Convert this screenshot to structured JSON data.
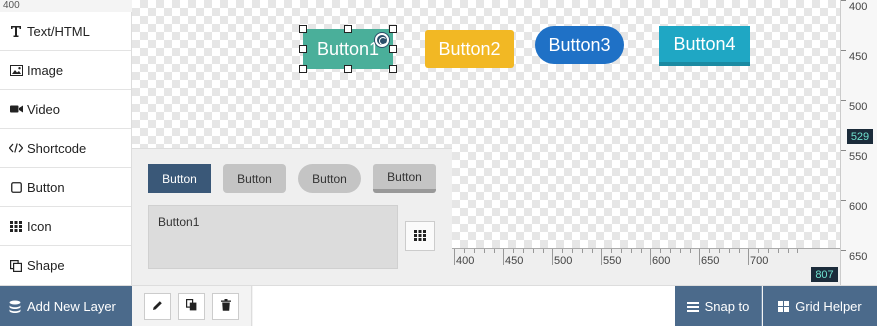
{
  "corner_coord": "400",
  "sidebar": {
    "items": [
      {
        "label": "Text/HTML",
        "icon": "text-icon"
      },
      {
        "label": "Image",
        "icon": "image-icon"
      },
      {
        "label": "Video",
        "icon": "video-camera-icon"
      },
      {
        "label": "Shortcode",
        "icon": "code-icon"
      },
      {
        "label": "Button",
        "icon": "square-icon"
      },
      {
        "label": "Icon",
        "icon": "grid-icon"
      },
      {
        "label": "Shape",
        "icon": "copy-icon"
      }
    ]
  },
  "canvas": {
    "buttons": [
      "Button1",
      "Button2",
      "Button3",
      "Button4"
    ],
    "colors": {
      "button1": "#4aaf9a",
      "button2": "#f2b824",
      "button3": "#1f71c6",
      "button4": "#1fa7c4"
    }
  },
  "vruler": {
    "labels": [
      "400",
      "450",
      "500",
      "550",
      "600",
      "650"
    ],
    "marker": "529"
  },
  "hruler": {
    "labels": [
      "400",
      "450",
      "500",
      "550",
      "600",
      "650",
      "700"
    ],
    "marker": "807"
  },
  "panel": {
    "styles": [
      "Button",
      "Button",
      "Button",
      "Button"
    ],
    "text_value": "Button1"
  },
  "bottombar": {
    "add_layer": "Add New Layer",
    "snap_to": "Snap to",
    "grid_helper": "Grid Helper"
  }
}
